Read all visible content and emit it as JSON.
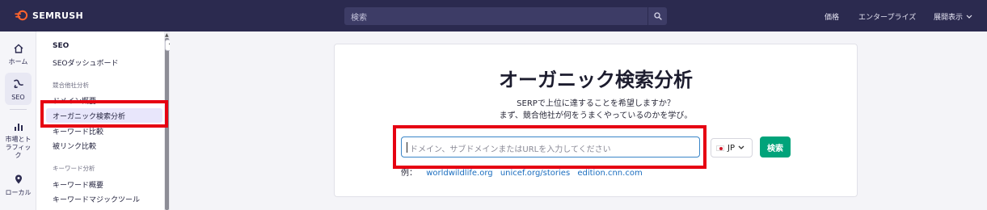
{
  "header": {
    "brand": "SEMRUSH",
    "search_placeholder": "検索",
    "nav": [
      "価格",
      "エンタープライズ",
      "展開表示"
    ]
  },
  "rail": [
    {
      "label": "ホーム",
      "icon": "home-icon",
      "active": false
    },
    {
      "label": "SEO",
      "icon": "seo-icon",
      "active": true
    },
    {
      "label": "市場とトラフィック",
      "icon": "bar-chart-icon",
      "active": false
    },
    {
      "label": "ローカル",
      "icon": "location-pin-icon",
      "active": false
    }
  ],
  "sidebar": {
    "heading": "SEO",
    "dashboard": "SEOダッシュボード",
    "section_competitors": "競合他社分析",
    "domain_overview": "ドメイン概要",
    "organic_research": "オーガニック検索分析",
    "keyword_gap": "キーワード比較",
    "backlink_gap": "被リンク比較",
    "section_keywords": "キーワード分析",
    "keyword_overview": "キーワード概要",
    "keyword_magic": "キーワードマジックツール"
  },
  "main": {
    "title": "オーガニック検索分析",
    "subtitle_1": "SERPで上位に達することを希望しますか？",
    "subtitle_2": "まず、競合他社が何をうまくやっているのかを学び。",
    "input_placeholder": "ドメイン、サブドメインまたはURLを入力してください",
    "database": "JP",
    "search_button": "検索",
    "examples_prefix": "例：",
    "examples": [
      "worldwildlife.org",
      "unicef.org/stories",
      "edition.cnn.com"
    ]
  },
  "colors": {
    "header_bg": "#2b2a4f",
    "brand_orange": "#ff642d",
    "accent_green": "#00a37a",
    "link_blue": "#1a6dbf",
    "highlight_red": "#e60012"
  }
}
